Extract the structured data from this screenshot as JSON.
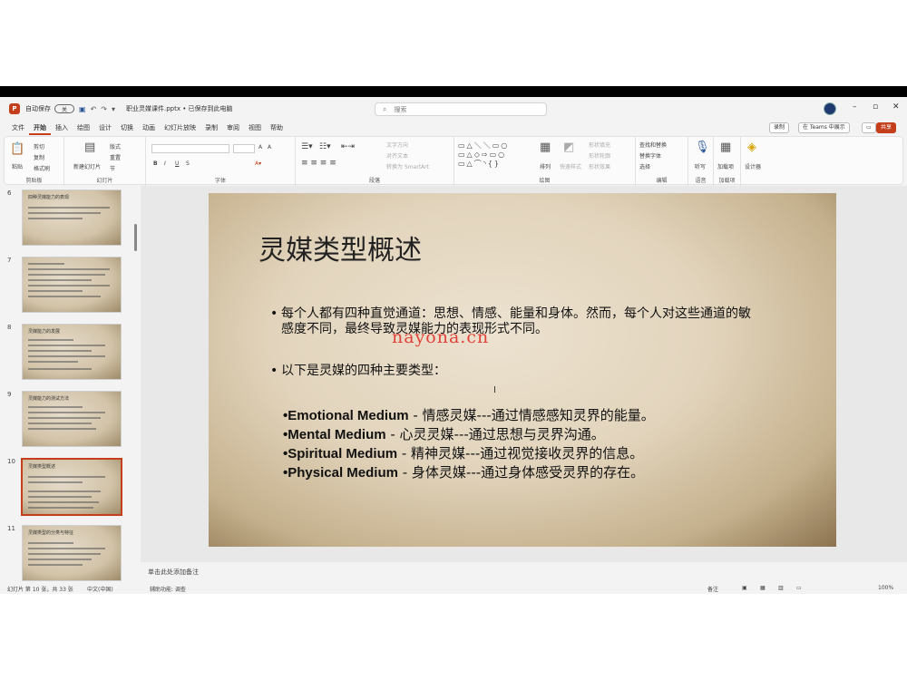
{
  "titlebar": {
    "autosave_label": "自动保存",
    "autosave_state": "关",
    "doc_name": "职业灵媒课件.pptx • 已保存到此电脑",
    "search_placeholder": "搜索"
  },
  "menu": {
    "tabs": [
      "文件",
      "开始",
      "插入",
      "绘图",
      "设计",
      "切换",
      "动画",
      "幻灯片放映",
      "录制",
      "审阅",
      "视图",
      "帮助"
    ],
    "active": "开始",
    "right_buttons": {
      "record": "录制",
      "teams": "在 Teams 中展示",
      "share": "共享"
    }
  },
  "ribbon": {
    "groups": [
      {
        "label": "剪贴板",
        "items": [
          "粘贴",
          "剪切",
          "复制",
          "格式刷"
        ]
      },
      {
        "label": "幻灯片",
        "items": [
          "新建幻灯片",
          "版式",
          "重置",
          "节"
        ]
      },
      {
        "label": "字体",
        "items": [
          "A",
          "A",
          "B",
          "I",
          "U",
          "S"
        ]
      },
      {
        "label": "段落",
        "items": [
          "文字方向",
          "对齐文本",
          "转换为 SmartArt"
        ]
      },
      {
        "label": "绘图",
        "items": [
          "排列",
          "快速样式",
          "形状填充",
          "形状轮廓",
          "形状效果"
        ]
      },
      {
        "label": "编辑",
        "items": [
          "查找和替换",
          "替换字体",
          "选择"
        ]
      },
      {
        "label": "语音",
        "items": [
          "听写"
        ]
      },
      {
        "label": "加载项",
        "items": [
          "加载项"
        ]
      },
      {
        "label": "",
        "items": [
          "设计器"
        ]
      }
    ]
  },
  "thumbnails": [
    {
      "num": "6",
      "title": "四种灵媒能力的表现"
    },
    {
      "num": "7",
      "title": ""
    },
    {
      "num": "8",
      "title": "灵媒能力的发展"
    },
    {
      "num": "9",
      "title": "灵媒能力的测试方法"
    },
    {
      "num": "10",
      "title": "灵媒类型概述"
    },
    {
      "num": "11",
      "title": "灵媒类型的分类与特征"
    }
  ],
  "slide": {
    "title": "灵媒类型概述",
    "bullets": [
      "每个人都有四种直觉通道：思想、情感、能量和身体。然而，每个人对这些通道的敏感度不同，最终导致灵媒能力的表现形式不同。",
      "以下是灵媒的四种主要类型："
    ],
    "mediums": [
      {
        "name": "•Emotional Medium",
        "desc": " - 情感灵媒---通过情感感知灵界的能量。"
      },
      {
        "name": "•Mental Medium",
        "desc": " - 心灵灵媒---通过思想与灵界沟通。"
      },
      {
        "name": "•Spiritual Medium",
        "desc": " - 精神灵媒---通过视觉接收灵界的信息。"
      },
      {
        "name": "•Physical Medium",
        "desc": " - 身体灵媒---通过身体感受灵界的存在。"
      }
    ],
    "watermark": "nayona.cn"
  },
  "notes_placeholder": "单击此处添加备注",
  "status": {
    "slide_info": "幻灯片 第 10 张，共 33 张",
    "language": "中文(中国)",
    "accessibility": "辅助功能: 调查",
    "notes_btn": "备注",
    "zoom": "100%"
  }
}
